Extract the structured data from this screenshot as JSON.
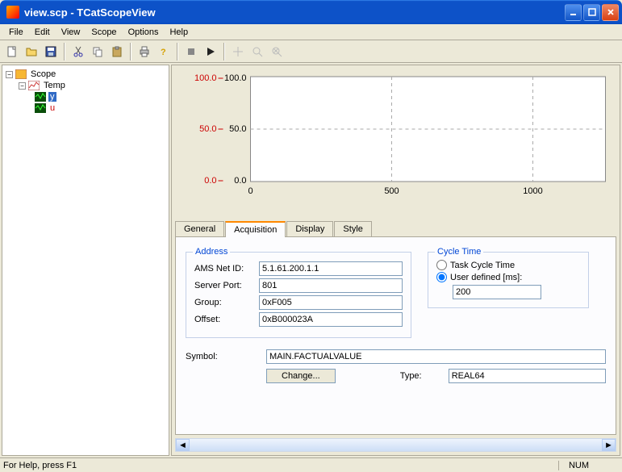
{
  "window": {
    "title": "view.scp - TCatScopeView"
  },
  "menu": {
    "file": "File",
    "edit": "Edit",
    "view": "View",
    "scope": "Scope",
    "options": "Options",
    "help": "Help"
  },
  "tree": {
    "root": "Scope",
    "group": "Temp",
    "ch_y": "y",
    "ch_u": "u"
  },
  "tabs": {
    "general": "General",
    "acquisition": "Acquisition",
    "display": "Display",
    "style": "Style"
  },
  "address": {
    "title": "Address",
    "ams_label": "AMS Net ID:",
    "ams": "5.1.61.200.1.1",
    "port_label": "Server Port:",
    "port": "801",
    "group_label": "Group:",
    "group": "0xF005",
    "offset_label": "Offset:",
    "offset": "0xB000023A"
  },
  "cycle": {
    "title": "Cycle Time",
    "task": "Task Cycle Time",
    "user": "User defined [ms]:",
    "value": "200"
  },
  "symbol": {
    "label": "Symbol:",
    "value": "MAIN.FACTUALVALUE",
    "change": "Change...",
    "type_label": "Type:",
    "type": "REAL64"
  },
  "status": {
    "help": "For Help, press F1",
    "num": "NUM"
  },
  "chart_data": {
    "type": "line",
    "title": "",
    "x": [
      0,
      500,
      1000
    ],
    "y_left_ticks": [
      0.0,
      50.0,
      100.0
    ],
    "y_right_ticks": [
      0.0,
      50.0,
      100.0
    ],
    "xlabel": "",
    "ylabel": "",
    "series": [
      {
        "name": "y",
        "color": "#cc0000",
        "values": []
      },
      {
        "name": "u",
        "color": "#006600",
        "values": []
      }
    ],
    "xlim": [
      0,
      1250
    ],
    "ylim": [
      0,
      100
    ]
  }
}
